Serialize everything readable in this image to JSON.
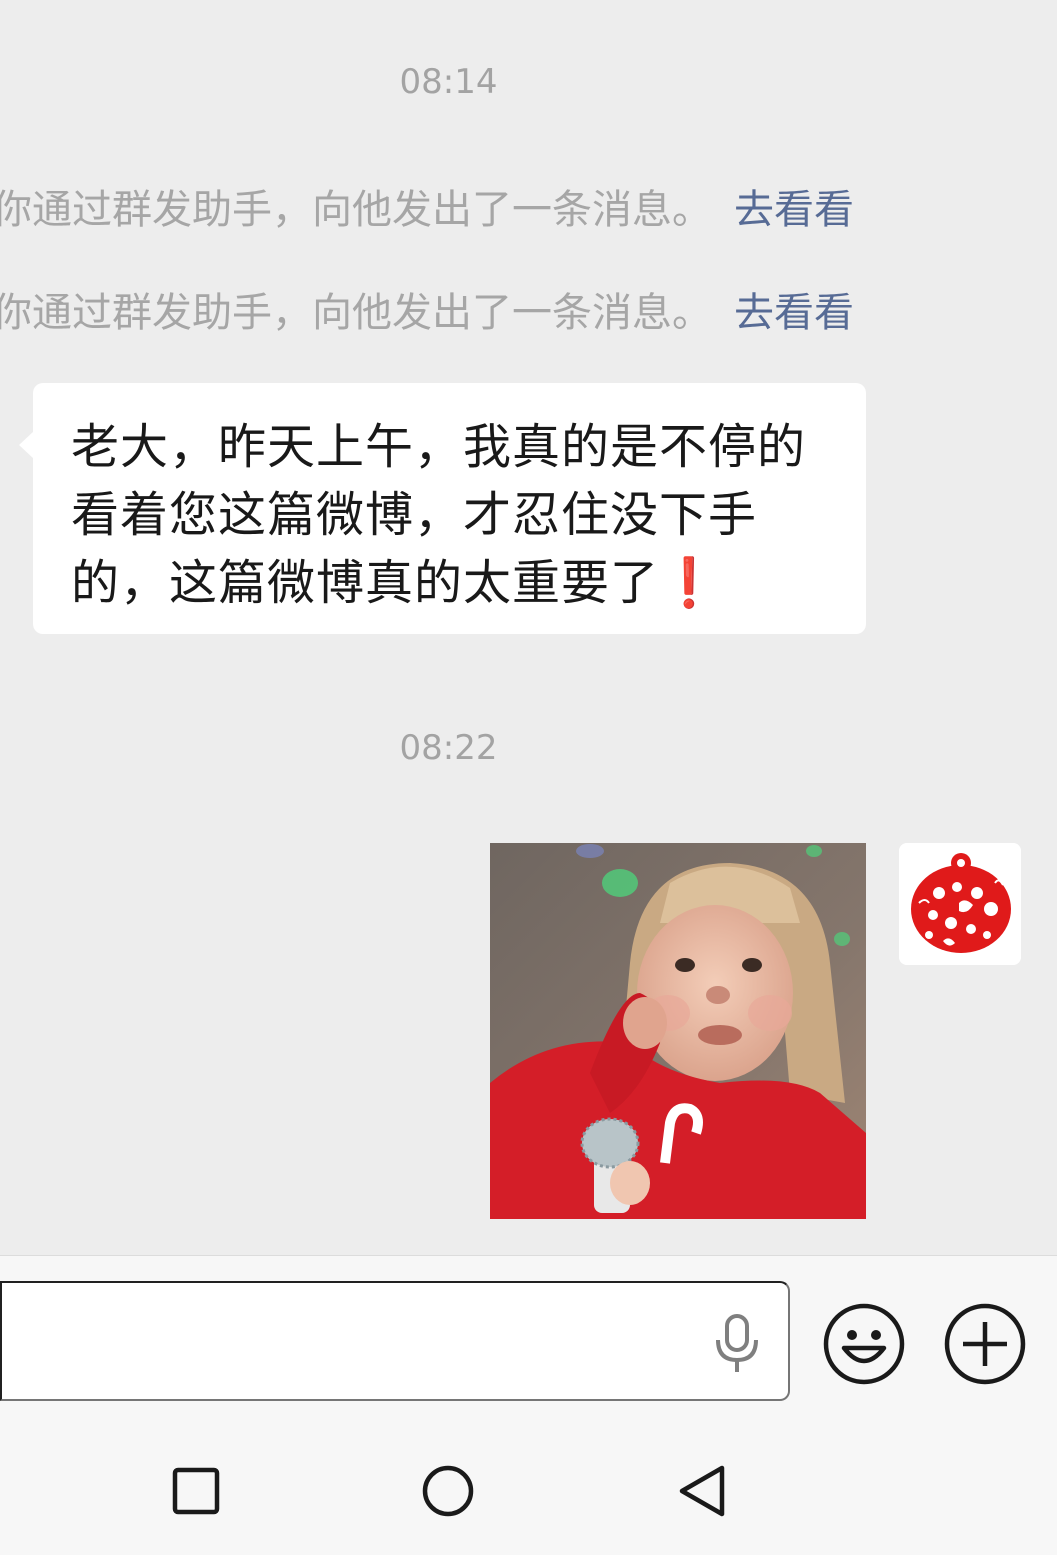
{
  "chat": {
    "time1": "08:14",
    "system_messages": [
      {
        "text": "你通过群发助手，向他发出了一条消息。",
        "link": "去看看"
      },
      {
        "text": "你通过群发助手，向他发出了一条消息。",
        "link": "去看看"
      }
    ],
    "incoming_message": {
      "text": "老大，昨天上午，我真的是不停的看着您这篇微博，才忍住没下手的，这篇微博真的太重要了",
      "emoji": "❗"
    },
    "time2": "08:22",
    "outgoing_sticker": {
      "subject": "sticker-girl-with-microphone"
    },
    "avatar": {
      "style": "red-papercut"
    }
  },
  "input_bar": {
    "value": "",
    "voice_icon": "microphone-icon",
    "emoji_icon": "smiley-icon",
    "more_icon": "plus-circle-icon"
  },
  "nav": {
    "recent_icon": "square-icon",
    "home_icon": "circle-icon",
    "back_icon": "triangle-back-icon"
  },
  "colors": {
    "chat_bg": "#ededed",
    "bubble": "#ffffff",
    "link": "#576b95",
    "timestamp": "#a3a3a3"
  }
}
